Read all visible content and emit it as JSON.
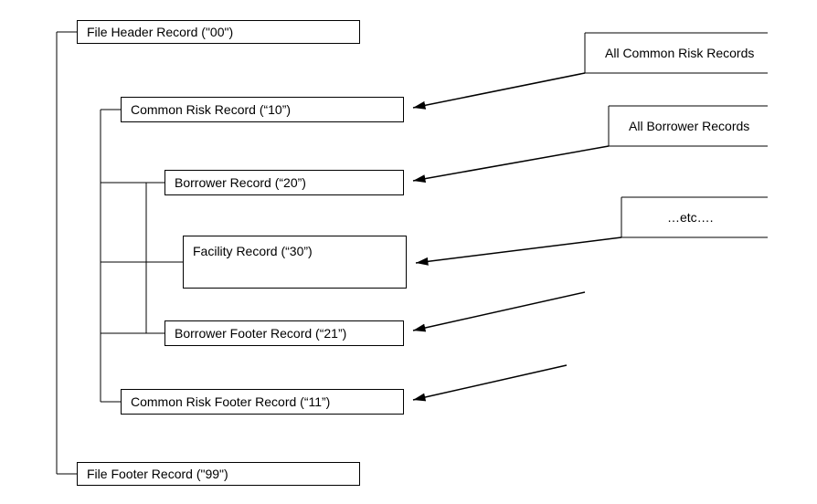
{
  "diagram": {
    "boxes": {
      "file_header": "File Header Record (\"00\")",
      "common_risk": "Common Risk Record (“10”)",
      "borrower": "Borrower Record (“20”)",
      "facility": "Facility Record (“30”)",
      "borrower_footer": "Borrower Footer Record (“21”)",
      "common_risk_footer": "Common Risk Footer Record (“11”)",
      "file_footer": "File Footer Record (\"99\")"
    },
    "callouts": {
      "all_common_risk": "All Common Risk Records",
      "all_borrower": "All Borrower Records",
      "etc": "…etc…."
    }
  }
}
